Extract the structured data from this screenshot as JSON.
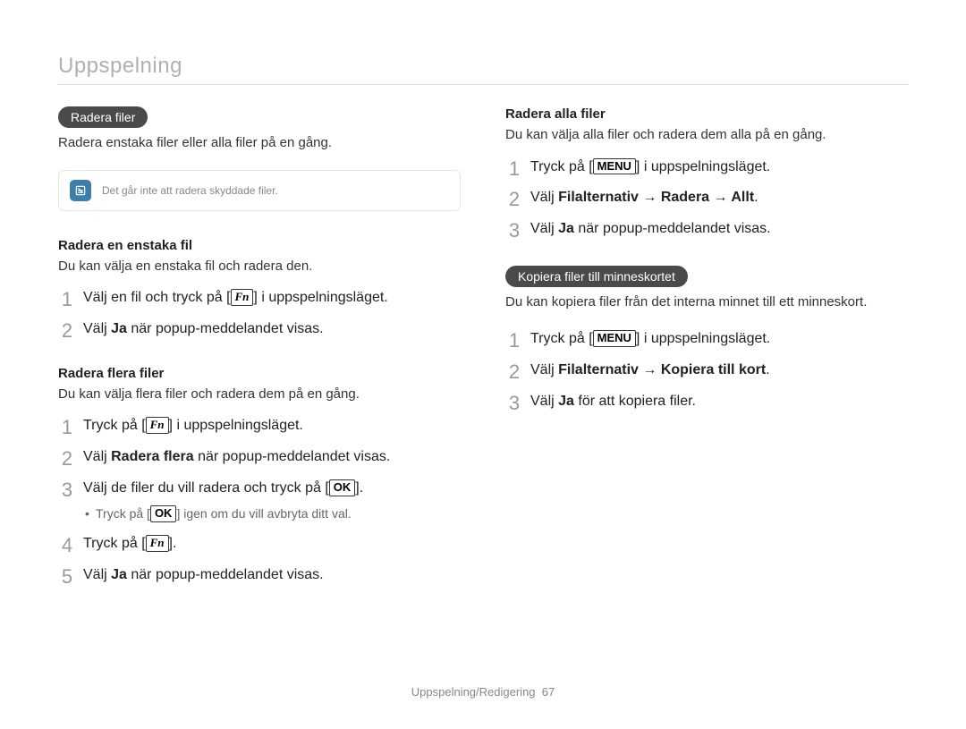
{
  "page_title": "Uppspelning",
  "footer": {
    "section": "Uppspelning/Redigering",
    "page_number": "67"
  },
  "buttons": {
    "fn": "Fn",
    "ok": "OK",
    "menu": "MENU"
  },
  "left": {
    "pill1": "Radera filer",
    "pill1_intro": "Radera enstaka filer eller alla filer på en gång.",
    "note": "Det går inte att radera skyddade filer.",
    "sec1": {
      "heading": "Radera en enstaka fil",
      "desc": "Du kan välja en enstaka fil och radera den.",
      "steps": [
        {
          "pre": "Välj en fil och tryck på [",
          "btn": "fn",
          "post": "] i uppspelningsläget."
        },
        {
          "pre": "Välj ",
          "bold": "Ja",
          "post": " när popup-meddelandet visas."
        }
      ]
    },
    "sec2": {
      "heading": "Radera flera filer",
      "desc": "Du kan välja flera filer och radera dem på en gång.",
      "steps": [
        {
          "pre": "Tryck på [",
          "btn": "fn",
          "post": "] i uppspelningsläget."
        },
        {
          "pre": "Välj ",
          "bold": "Radera flera",
          "post": " när popup-meddelandet visas."
        },
        {
          "pre": "Välj de filer du vill radera och tryck på [",
          "btn": "ok",
          "post": "].",
          "sub": {
            "pre": "Tryck på [",
            "btn": "ok",
            "post": "] igen om du vill avbryta ditt val."
          }
        },
        {
          "pre": "Tryck på [",
          "btn": "fn",
          "post": "]."
        },
        {
          "pre": "Välj ",
          "bold": "Ja",
          "post": " när popup-meddelandet visas."
        }
      ]
    }
  },
  "right": {
    "sec1": {
      "heading": "Radera alla filer",
      "desc": "Du kan välja alla filer och radera dem alla på en gång.",
      "steps": [
        {
          "pre": "Tryck på [",
          "btn": "menu",
          "post": "] i uppspelningsläget."
        },
        {
          "pre": "Välj ",
          "bold": "Filalternativ → Radera → Allt",
          "post": "."
        },
        {
          "pre": "Välj ",
          "bold": "Ja",
          "post": " när popup-meddelandet visas."
        }
      ]
    },
    "pill2": "Kopiera filer till minneskortet",
    "pill2_intro": "Du kan kopiera filer från det interna minnet till ett minneskort.",
    "sec2": {
      "steps": [
        {
          "pre": "Tryck på [",
          "btn": "menu",
          "post": "] i uppspelningsläget."
        },
        {
          "pre": "Välj ",
          "bold": "Filalternativ → Kopiera till kort",
          "post": "."
        },
        {
          "pre": "Välj ",
          "bold": "Ja",
          "post": " för att kopiera filer."
        }
      ]
    }
  }
}
